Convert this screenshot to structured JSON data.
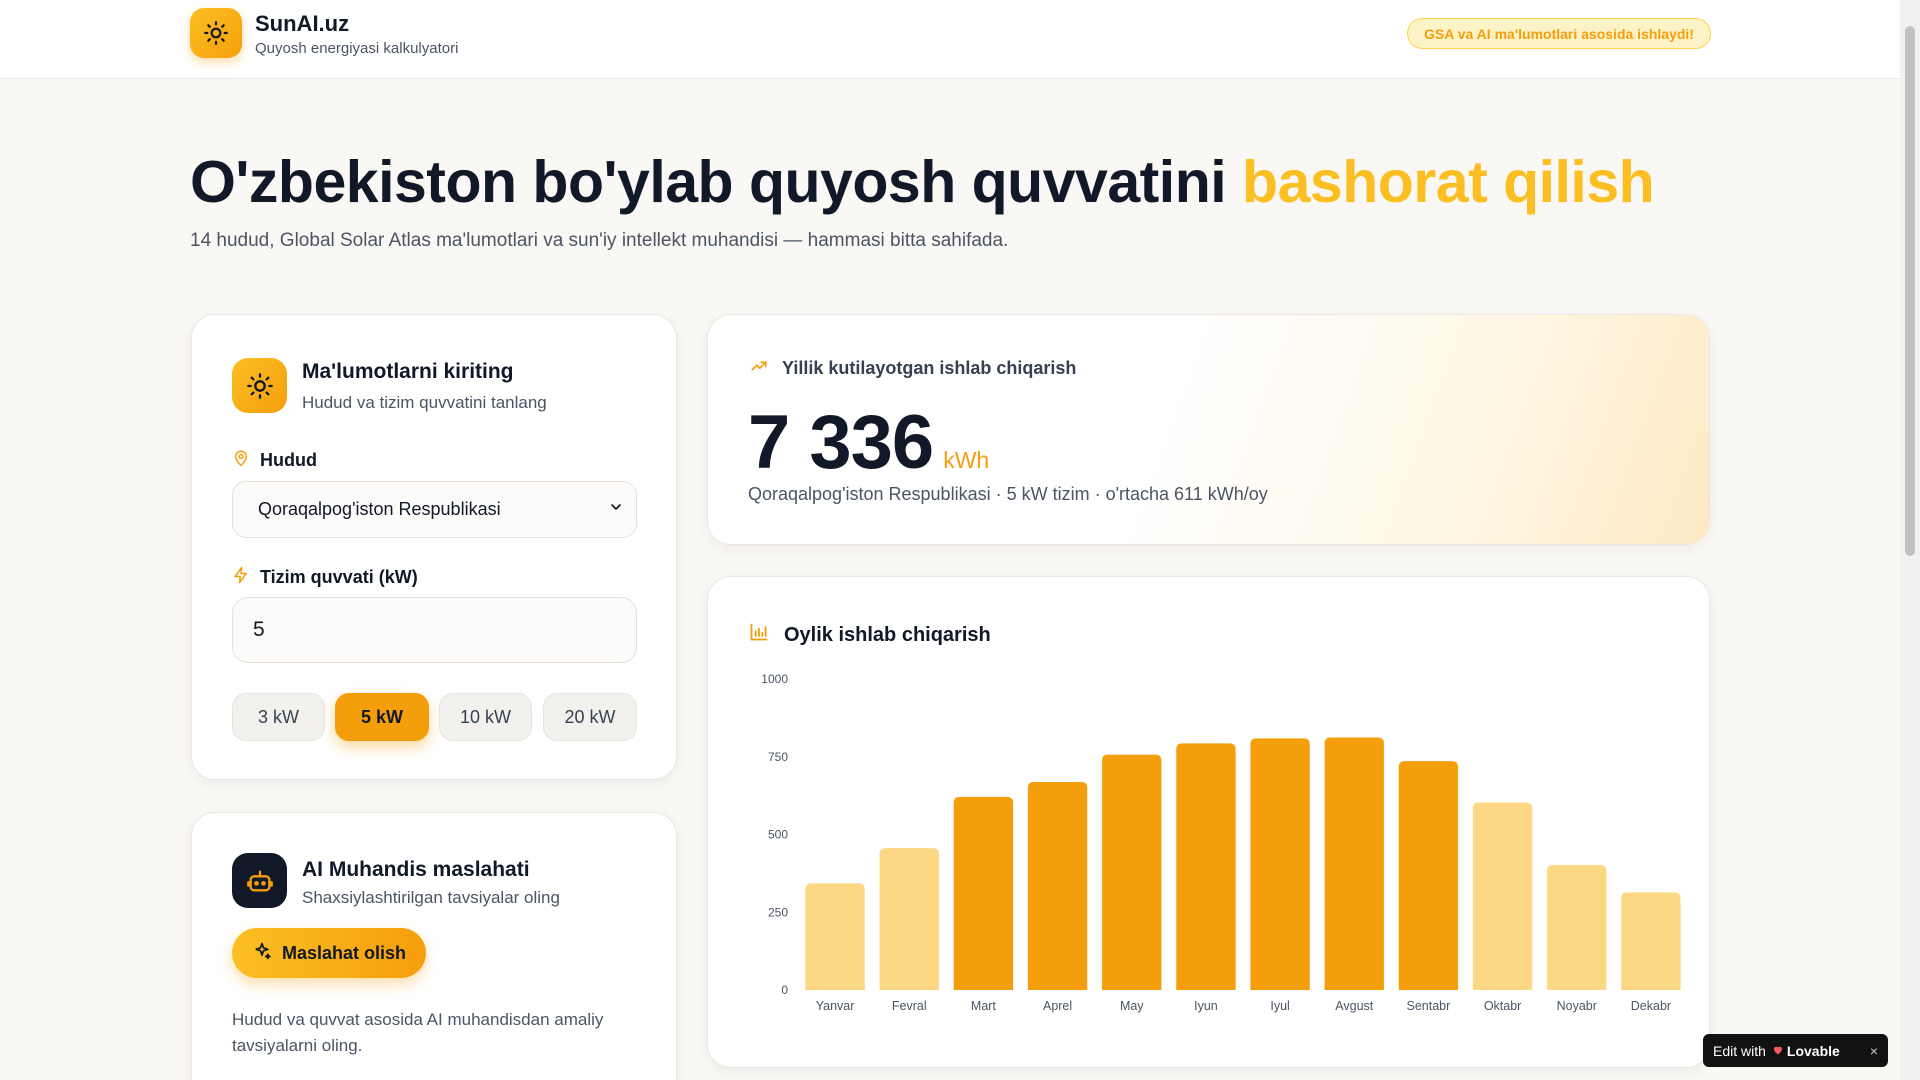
{
  "header": {
    "brand_name": "SunAI.uz",
    "brand_subtitle": "Quyosh energiyasi kalkulyatori",
    "badge": "GSA va AI ma'lumotlari asosida ishlaydi!"
  },
  "hero": {
    "title_main": "O'zbekiston bo'ylab quyosh quvvatini",
    "title_accent": "bashorat qilish",
    "subtitle": "14 hudud, Global Solar Atlas ma'lumotlari va sun'iy intellekt muhandisi — hammasi bitta sahifada."
  },
  "input_card": {
    "title": "Ma'lumotlarni kiriting",
    "subtitle": "Hudud va tizim quvvatini tanlang",
    "region_label": "Hudud",
    "region_value": "Qoraqalpog'iston Respublikasi",
    "power_label": "Tizim quvvati (kW)",
    "power_value": "5",
    "presets": [
      "3 kW",
      "5 kW",
      "10 kW",
      "20 kW"
    ],
    "active_preset": 1
  },
  "ai_card": {
    "title": "AI Muhandis maslahati",
    "subtitle": "Shaxsiylashtirilgan tavsiyalar oling",
    "button": "Maslahat olish",
    "note": "Hudud va quvvat asosida AI muhandisdan amaliy tavsiyalarni oling."
  },
  "annual": {
    "label": "Yillik kutilayotgan ishlab chiqarish",
    "value": "7 336",
    "unit": "kWh",
    "summary": "Qoraqalpog'iston Respublikasi · 5 kW tizim · o'rtacha 611 kWh/oy"
  },
  "chart_card": {
    "title": "Oylik ishlab chiqarish"
  },
  "chart_data": {
    "type": "bar",
    "title": "Oylik ishlab chiqarish",
    "categories": [
      "Yanvar",
      "Fevral",
      "Mart",
      "Aprel",
      "May",
      "Iyun",
      "Iyul",
      "Avgust",
      "Sentabr",
      "Oktabr",
      "Noyabr",
      "Dekabr"
    ],
    "values": [
      343,
      456,
      621,
      669,
      757,
      793,
      809,
      812,
      736,
      603,
      402,
      314
    ],
    "ylim": [
      0,
      1000
    ],
    "yticks": [
      0,
      250,
      500,
      750,
      1000
    ],
    "grid": false,
    "colors": {
      "high": "#f59e0b",
      "low": "#fcd884"
    },
    "highlight": [
      false,
      false,
      true,
      true,
      true,
      true,
      true,
      true,
      true,
      false,
      false,
      false
    ]
  },
  "lovable": {
    "prefix": "Edit with",
    "brand": "Lovable",
    "close": "×"
  }
}
